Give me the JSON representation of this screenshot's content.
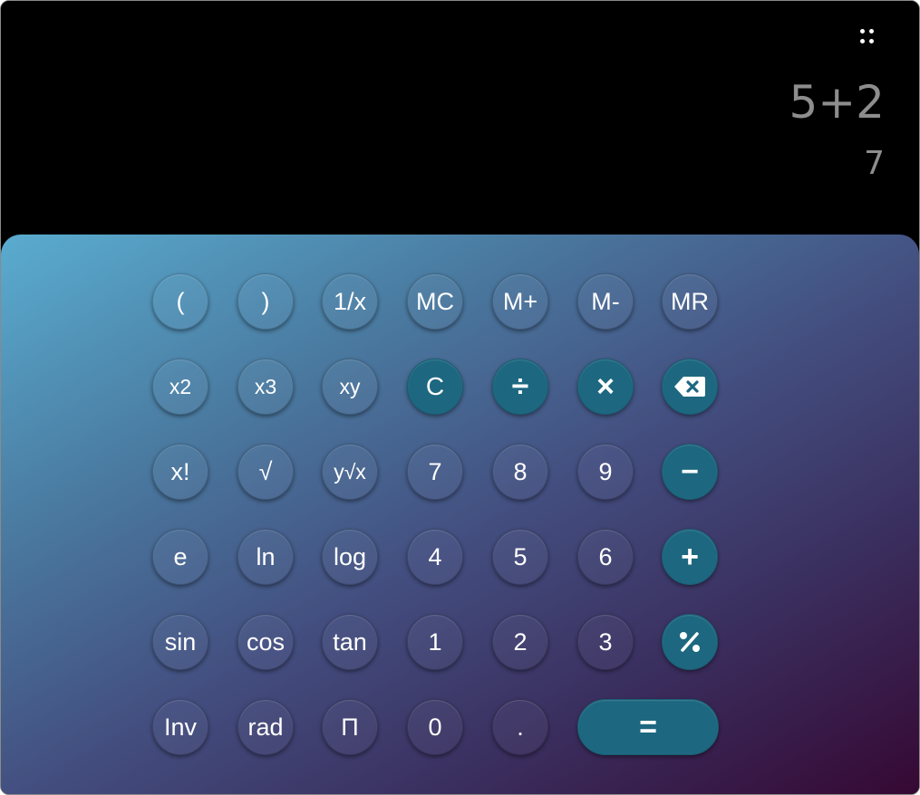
{
  "display": {
    "menu_icon": "dots-grid-icon",
    "expression": "5+2",
    "result": "7"
  },
  "colors": {
    "display_background": "#000000",
    "display_text": "#8d8d8d",
    "operator_button": "#1d6880",
    "gradient_start": "#5aacd0",
    "gradient_end": "#360833"
  },
  "keys": {
    "open_paren": "(",
    "close_paren": ")",
    "reciprocal": "1/x",
    "memory_clear": "MC",
    "memory_add": "M+",
    "memory_subtract": "M-",
    "memory_recall": "MR",
    "square": "x2",
    "cube": "x3",
    "power": "xy",
    "clear": "C",
    "divide": "÷",
    "multiply": "×",
    "backspace": "backspace-icon",
    "factorial": "x!",
    "sqrt": "√",
    "nth_root": "y√x",
    "seven": "7",
    "eight": "8",
    "nine": "9",
    "minus": "−",
    "e": "e",
    "ln": "ln",
    "log": "log",
    "four": "4",
    "five": "5",
    "six": "6",
    "plus": "+",
    "sin": "sin",
    "cos": "cos",
    "tan": "tan",
    "one": "1",
    "two": "2",
    "three": "3",
    "percent": "percent-icon",
    "inv": "Inv",
    "rad": "rad",
    "pi": "Π",
    "zero": "0",
    "decimal": ".",
    "equals": "="
  }
}
